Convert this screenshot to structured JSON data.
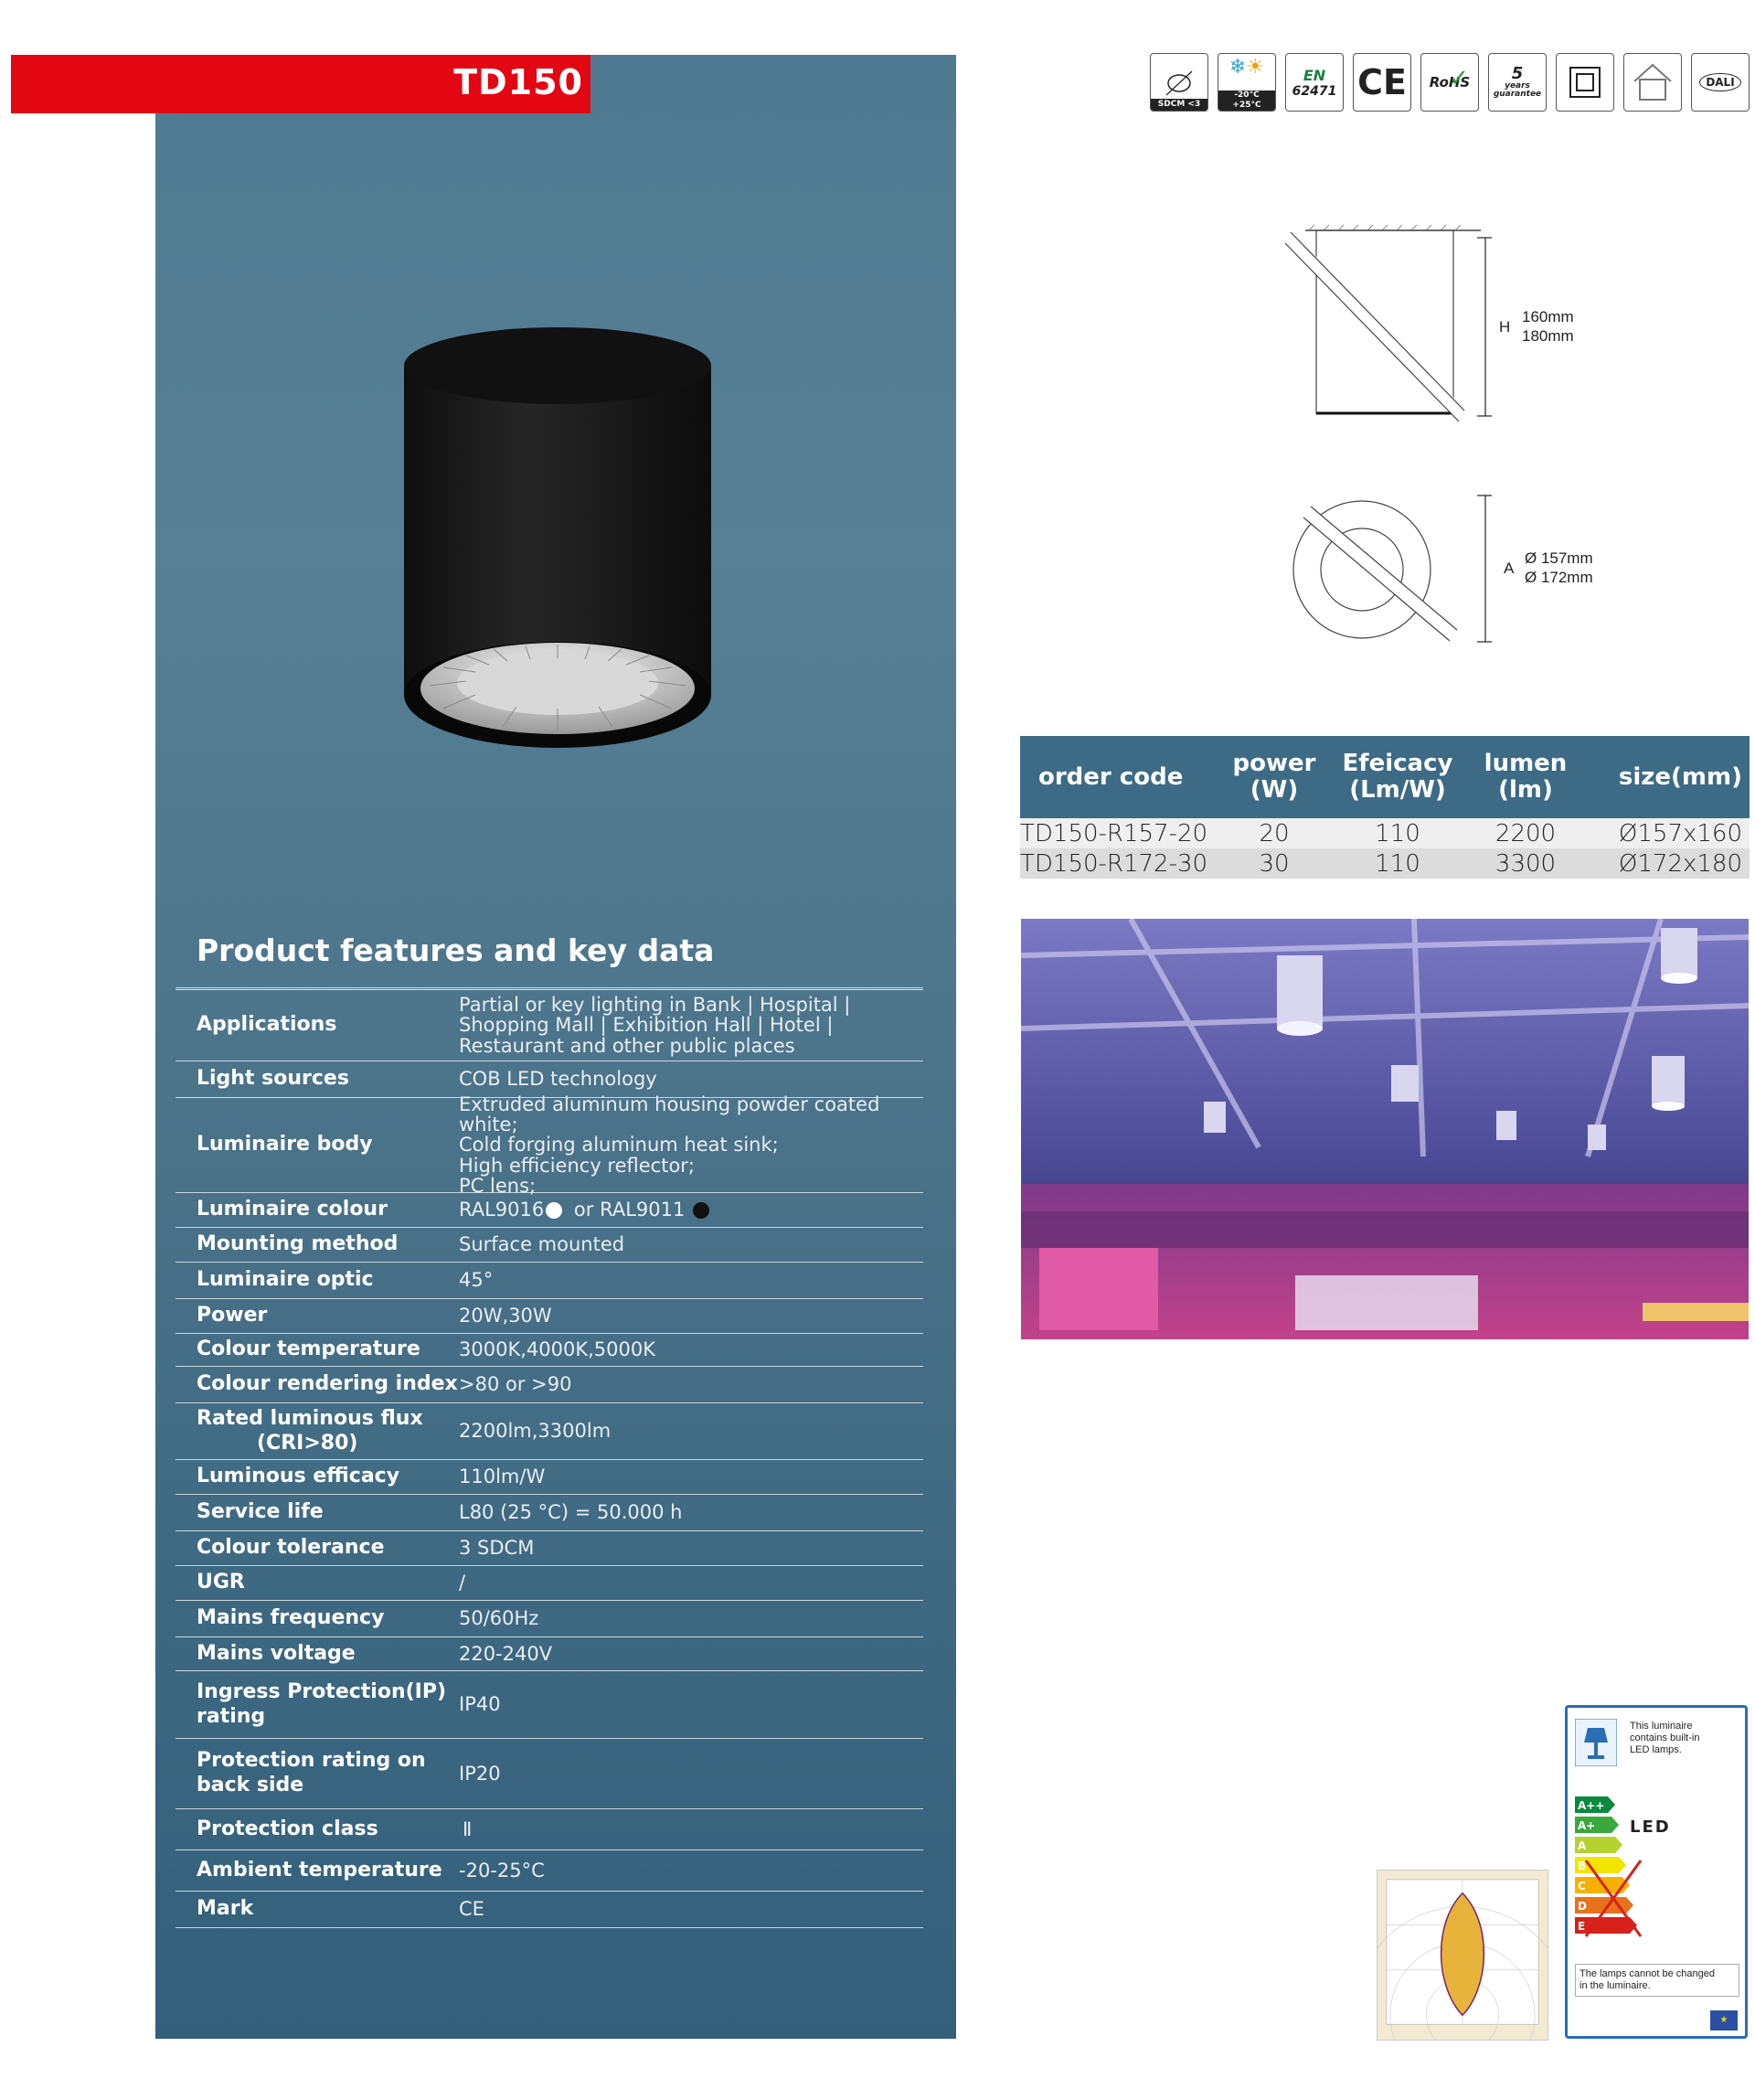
{
  "header": {
    "model": "TD150"
  },
  "certifications": [
    {
      "name": "sdcm-icon",
      "label": "SDCM <3"
    },
    {
      "name": "temperature-icon",
      "label_top": "-20°C",
      "label_bottom": "+25°C"
    },
    {
      "name": "en-standard-icon",
      "label_top": "EN",
      "label_bottom": "62471"
    },
    {
      "name": "ce-icon",
      "label": "CE"
    },
    {
      "name": "rohs-icon",
      "label": "RoHS"
    },
    {
      "name": "warranty-icon",
      "label_top": "5",
      "label_mid": "years",
      "label_bottom": "guarantee"
    },
    {
      "name": "class-ii-icon",
      "label": ""
    },
    {
      "name": "indoor-icon",
      "label": ""
    },
    {
      "name": "dali-icon",
      "label": "DALI"
    }
  ],
  "dimensions": {
    "height_label": "H",
    "heights": [
      "160mm",
      "180mm"
    ],
    "diameter_label": "A",
    "diameters": [
      "Ø 157mm",
      "Ø 172mm"
    ]
  },
  "order_table": {
    "headers": {
      "code": "order code",
      "power_1": "power",
      "power_2": "(W)",
      "efficacy_1": "Efeicacy",
      "efficacy_2": "(Lm/W)",
      "lumen_1": "lumen",
      "lumen_2": "(lm)",
      "size": "size(mm)"
    },
    "rows": [
      {
        "code": "TD150-R157-20",
        "power": "20",
        "efficacy": "110",
        "lumen": "2200",
        "size": "Ø157x160"
      },
      {
        "code": "TD150-R172-30",
        "power": "30",
        "efficacy": "110",
        "lumen": "3300",
        "size": "Ø172x180"
      }
    ]
  },
  "features": {
    "title": "Product features and key data",
    "rows": [
      {
        "label": "Applications",
        "lines": [
          "Partial or key lighting in Bank | Hospital |",
          "Shopping Mall | Exhibition Hall | Hotel |",
          "Restaurant and other public places"
        ]
      },
      {
        "label": "Light sources",
        "lines": [
          "COB LED technology"
        ]
      },
      {
        "label": "Luminaire body",
        "lines": [
          "Extruded aluminum housing powder coated white;",
          "Cold forging aluminum heat sink;",
          "High efficiency reflector;",
          "PC lens;"
        ]
      },
      {
        "label": "Luminaire colour",
        "value_a": "RAL9016",
        "value_mid": " or RAL9011 "
      },
      {
        "label": "Mounting method",
        "lines": [
          "Surface mounted"
        ]
      },
      {
        "label": "Luminaire optic",
        "lines": [
          "45°"
        ]
      },
      {
        "label": "Power",
        "lines": [
          "20W,30W"
        ]
      },
      {
        "label": "Colour temperature",
        "lines": [
          "3000K,4000K,5000K"
        ]
      },
      {
        "label": "Colour rendering index",
        "lines": [
          ">80 or >90"
        ]
      },
      {
        "label": "Rated luminous flux",
        "label2": "(CRI>80)",
        "lines": [
          "2200lm,3300lm"
        ]
      },
      {
        "label": "Luminous efficacy",
        "lines": [
          "110lm/W"
        ]
      },
      {
        "label": "Service life",
        "lines": [
          "L80 (25 °C) = 50.000 h"
        ]
      },
      {
        "label": "Colour tolerance",
        "lines": [
          "3 SDCM"
        ]
      },
      {
        "label": "UGR",
        "lines": [
          "/"
        ]
      },
      {
        "label": "Mains frequency",
        "lines": [
          "50/60Hz"
        ]
      },
      {
        "label": "Mains voltage",
        "lines": [
          "220-240V"
        ]
      },
      {
        "label": "Ingress Protection(IP)",
        "label2": "rating",
        "lines": [
          "IP40"
        ]
      },
      {
        "label": "Protection rating on",
        "label2": "back side",
        "lines": [
          "IP20"
        ]
      },
      {
        "label": "Protection class",
        "lines": [
          "Ⅱ"
        ]
      },
      {
        "label": "Ambient temperature",
        "lines": [
          "-20-25°C"
        ]
      },
      {
        "label": "Mark",
        "lines": [
          "CE"
        ]
      }
    ]
  },
  "energy_label": {
    "top_text": [
      "This luminaire",
      "contains built-in",
      "LED lamps."
    ],
    "led": "LED",
    "classes": [
      "A++",
      "A+",
      "A",
      "B",
      "C",
      "D",
      "E"
    ],
    "bottom_text": [
      "The lamps cannot be changed",
      "in the luminaire."
    ]
  },
  "colors": {
    "title_red": "#e30613",
    "panel_blue": "#4a7289",
    "table_header_blue": "#3d6b86"
  }
}
